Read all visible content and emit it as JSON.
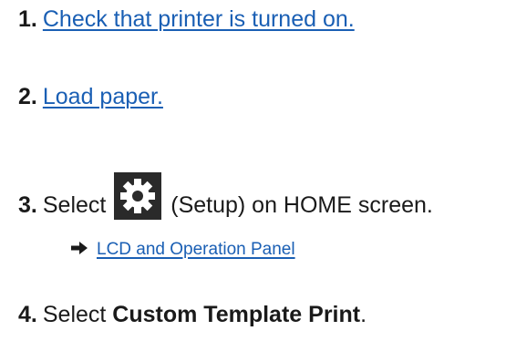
{
  "steps": [
    {
      "number": "1.",
      "link_text": "Check that printer is turned on."
    },
    {
      "number": "2.",
      "link_text": "Load paper."
    },
    {
      "number": "3.",
      "text_before": "Select",
      "icon": "gear-icon",
      "text_after": " (Setup) on HOME screen.",
      "sub_link": {
        "icon": "right-arrow-icon",
        "text": "LCD and Operation Panel"
      }
    },
    {
      "number": "4.",
      "text_before": "Select ",
      "bold_text": "Custom Template Print",
      "text_after": "."
    }
  ],
  "colors": {
    "link": "#1a5fb4",
    "text": "#1a1a1a",
    "icon_bg": "#2a2a2a"
  }
}
